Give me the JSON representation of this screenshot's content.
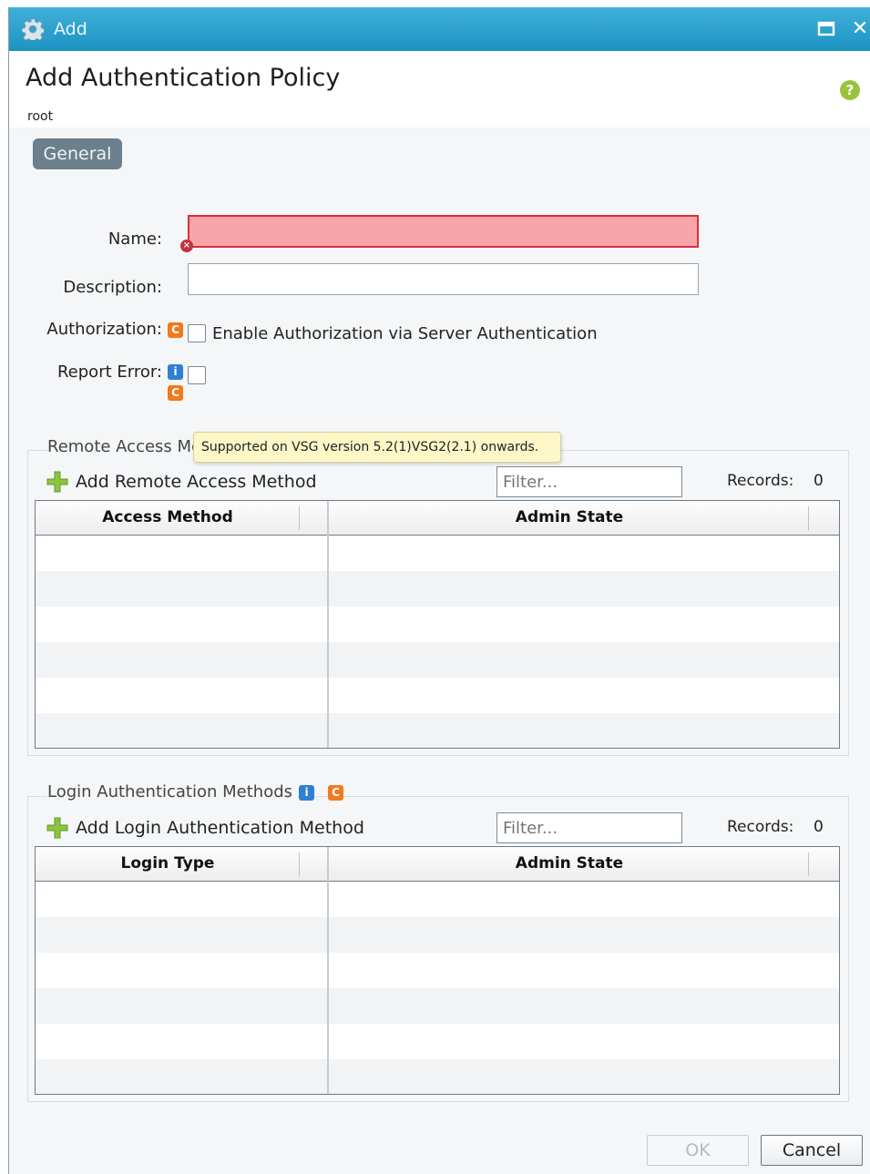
{
  "window": {
    "title": "Add"
  },
  "header": {
    "title": "Add Authentication Policy",
    "breadcrumb": "root"
  },
  "tabs": [
    {
      "label": "General",
      "selected": true
    }
  ],
  "form": {
    "name_label": "Name:",
    "name_value": "",
    "description_label": "Description:",
    "description_value": "",
    "authorization_label": "Authorization:",
    "authorization_checkbox_label": "Enable Authorization via Server Authentication",
    "authorization_checked": false,
    "report_error_label": "Report Error:",
    "report_error_checked": false
  },
  "tooltip": {
    "text": "Supported on VSG version 5.2(1)VSG2(2.1) onwards."
  },
  "remote_access": {
    "title": "Remote Access Me",
    "add_label": "Add Remote Access Method",
    "filter_placeholder": "Filter...",
    "records_label": "Records:",
    "records_count": "0",
    "columns": [
      "Access Method",
      "Admin State"
    ],
    "rows": []
  },
  "login_auth": {
    "title": "Login Authentication Methods",
    "add_label": "Add Login Authentication Method",
    "filter_placeholder": "Filter...",
    "records_label": "Records:",
    "records_count": "0",
    "columns": [
      "Login Type",
      "Admin State"
    ],
    "rows": []
  },
  "footer": {
    "ok_label": "OK",
    "cancel_label": "Cancel"
  },
  "colors": {
    "titlebar": "#1d93c4",
    "error_field": "#f7a5a8",
    "badge_c": "#f07a1e",
    "badge_i": "#2f7fd3",
    "tooltip_bg": "#fdf7c7"
  }
}
